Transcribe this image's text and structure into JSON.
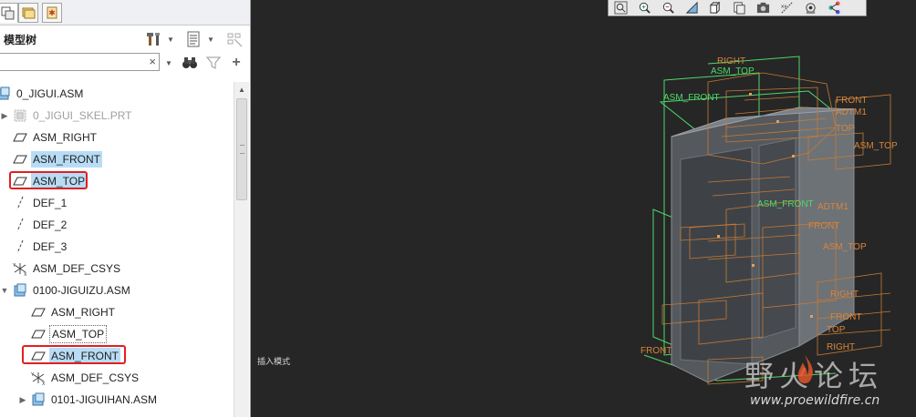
{
  "colors": {
    "highlight": "#b8dcf5",
    "red_box": "#e02020",
    "viewport_bg": "#262626",
    "datum_orange": "#d9843a",
    "datum_green": "#4fd86a"
  },
  "left_panel": {
    "tabs": [
      {
        "icon": "layers-icon"
      },
      {
        "icon": "folder-icon"
      },
      {
        "icon": "star-page-icon"
      }
    ],
    "title": "模型树",
    "search": {
      "value": "",
      "clear_glyph": "×"
    },
    "tree": [
      {
        "label": "0_JIGUI.ASM",
        "icon": "assembly-icon",
        "highlighted": false
      },
      {
        "label": "0_JIGUI_SKEL.PRT",
        "icon": "skeleton-part-icon",
        "expander": "▶",
        "dim": true
      },
      {
        "label": "ASM_RIGHT",
        "icon": "datum-plane-icon"
      },
      {
        "label": "ASM_FRONT",
        "icon": "datum-plane-icon",
        "highlighted": true
      },
      {
        "label": "ASM_TOP",
        "icon": "datum-plane-icon",
        "highlighted": true,
        "boxed": true
      },
      {
        "label": "DEF_1",
        "icon": "datum-axis-icon"
      },
      {
        "label": "DEF_2",
        "icon": "datum-axis-icon"
      },
      {
        "label": "DEF_3",
        "icon": "datum-axis-icon"
      },
      {
        "label": "ASM_DEF_CSYS",
        "icon": "csys-icon"
      },
      {
        "label": "0100-JIGUIZU.ASM",
        "icon": "assembly-icon",
        "expander": "▼"
      },
      {
        "label": "ASM_RIGHT",
        "icon": "datum-plane-icon"
      },
      {
        "label": "ASM_TOP",
        "icon": "datum-plane-icon"
      },
      {
        "label": "ASM_FRONT",
        "icon": "datum-plane-icon",
        "highlighted": true,
        "boxed": true
      },
      {
        "label": "ASM_DEF_CSYS",
        "icon": "csys-icon"
      },
      {
        "label": "0101-JIGUIHAN.ASM",
        "icon": "assembly-icon",
        "expander": "▶"
      }
    ]
  },
  "viewport": {
    "status_text": "插入模式",
    "toolbar": [
      {
        "icon": "zoom-fit-icon"
      },
      {
        "icon": "zoom-in-icon"
      },
      {
        "icon": "zoom-out-icon"
      },
      {
        "icon": "repaint-icon"
      },
      {
        "icon": "display-style-icon"
      },
      {
        "icon": "saved-views-icon"
      },
      {
        "icon": "view-manager-icon"
      },
      {
        "icon": "datum-display-icon"
      },
      {
        "icon": "annotation-display-icon"
      },
      {
        "icon": "spin-center-icon"
      }
    ],
    "datum_labels": {
      "right": "RIGHT",
      "asm_top": "ASM_TOP",
      "asm_front": "ASM_FRONT",
      "front": "FRONT",
      "adtm1": "ADTM1",
      "top": "TOP",
      "asm_front_2": "ASM_FRONT",
      "adtm1_2": "ADTM1",
      "front_2": "FRONT",
      "asm_top_2": "ASM_TOP",
      "right_2": "RIGHT",
      "front_3": "FRONT",
      "top_2": "TOP",
      "right_3": "RIGHT",
      "front_4": "FRONT",
      "asm_top_3": "ASM_TOP"
    },
    "watermark": {
      "main": "野火论坛",
      "url": "www.proewildfire.cn"
    }
  }
}
